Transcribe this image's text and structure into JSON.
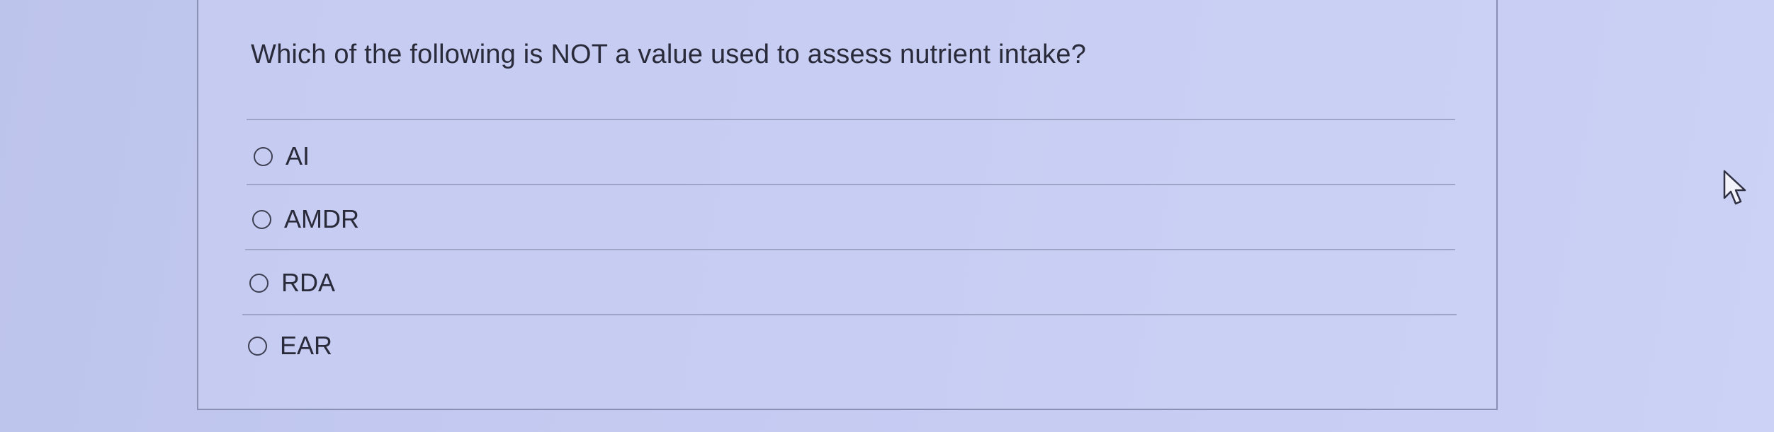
{
  "question": {
    "text": "Which of the following is NOT a value used to assess nutrient intake?"
  },
  "options": [
    {
      "label": "AI",
      "selected": false
    },
    {
      "label": "AMDR",
      "selected": false
    },
    {
      "label": "RDA",
      "selected": false
    },
    {
      "label": "EAR",
      "selected": false
    }
  ],
  "cursor": {
    "icon": "arrow-cursor-icon"
  },
  "colors": {
    "background": "#c4caf1",
    "text": "#2a2b3a",
    "divider": "#9fa4c6"
  }
}
